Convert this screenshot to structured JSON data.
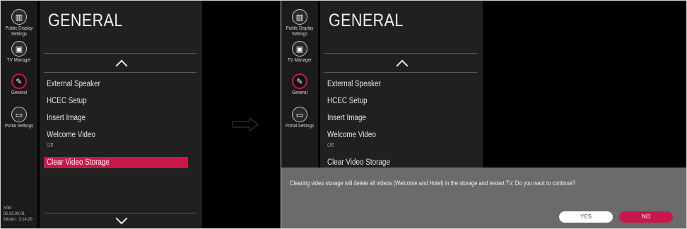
{
  "sidebar": {
    "items": [
      {
        "label": "Public Display Settings",
        "icon": "building-icon",
        "active": false
      },
      {
        "label": "TV Manager",
        "icon": "tv-manager-icon",
        "active": false
      },
      {
        "label": "General",
        "icon": "general-icon",
        "active": true
      },
      {
        "label": "Portal Settings",
        "icon": "portal-icon",
        "active": false
      }
    ],
    "version_line1": "S/W : 02.02.00.01",
    "version_line2": "Micom : 3.14.00"
  },
  "menu": {
    "title": "GENERAL",
    "items": [
      {
        "label": "External Speaker"
      },
      {
        "label": "HCEC Setup"
      },
      {
        "label": "Insert Image"
      },
      {
        "label": "Welcome Video",
        "sub": "Off"
      },
      {
        "label": "Clear Video Storage"
      }
    ]
  },
  "dialog": {
    "message": "Clearing video storage will delete all videos (Welcome and Hotel) in the storage and restart TV. Do you want to continue?",
    "yes_label": "YES",
    "no_label": "NO"
  },
  "colors": {
    "accent": "#c8184a",
    "menu_bg": "#202020",
    "sidebar_bg": "#1b1b1b",
    "dialog_bg": "#6b6b6b"
  }
}
